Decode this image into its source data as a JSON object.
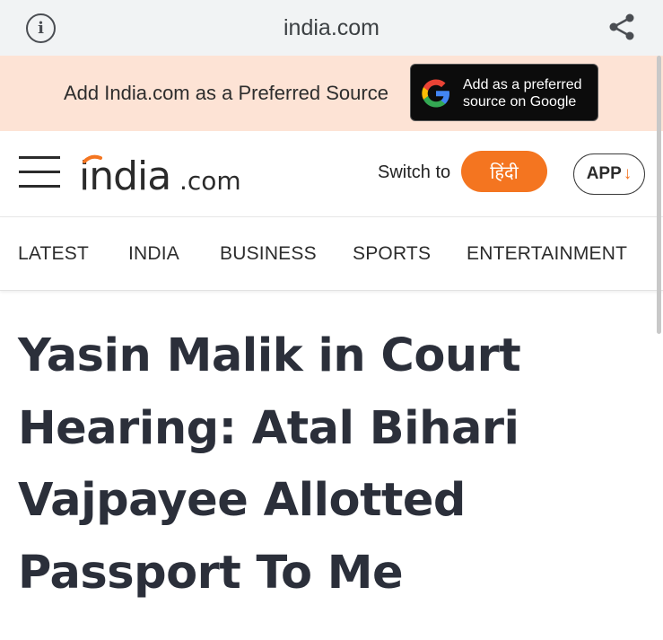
{
  "browser": {
    "url": "india.com",
    "icons": {
      "info": "info-icon",
      "share": "share-icon"
    }
  },
  "preferred_banner": {
    "text": "Add India.com as a Preferred Source",
    "button_line1": "Add as a preferred",
    "button_line2": "source on Google",
    "icon": "google-logo-icon"
  },
  "header": {
    "logo_main": "india",
    "logo_suffix": ".com",
    "switch_label": "Switch to",
    "hindi_button": "हिंदी",
    "app_button": "APP",
    "app_icon": "arrow-down-icon",
    "menu_icon": "hamburger-menu-icon"
  },
  "nav": {
    "items": [
      "LATEST",
      "INDIA",
      "BUSINESS",
      "SPORTS",
      "ENTERTAINMENT"
    ]
  },
  "article": {
    "headline_lines": [
      "Yasin Malik in Court",
      "Hearing: Atal Bihari",
      "Vajpayee Allotted",
      "Passport To Me"
    ]
  },
  "colors": {
    "accent": "#f47520",
    "banner_bg": "#fde3d5",
    "headline": "#2b2f3a"
  }
}
